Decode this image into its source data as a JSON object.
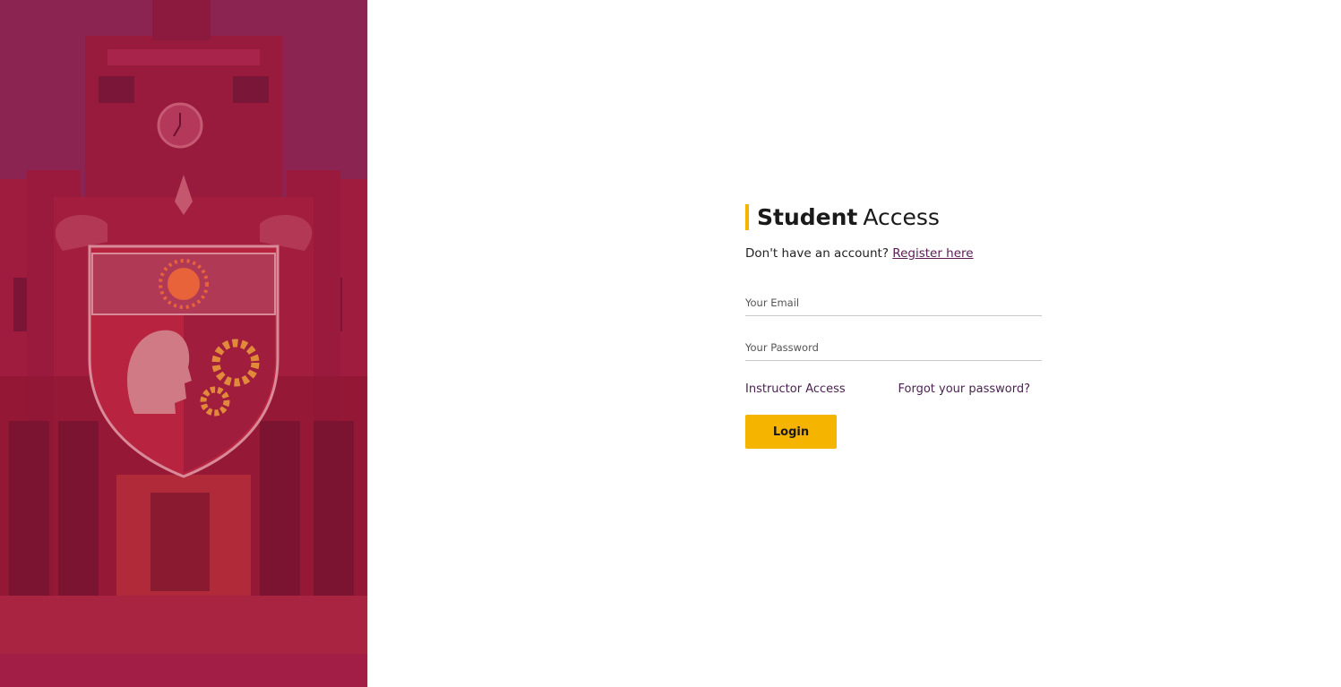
{
  "hero": {
    "image": "university-building-with-crest",
    "overlay_color": "#9e1c46"
  },
  "login": {
    "title_bold": "Student",
    "title_light": "Access",
    "register_prompt": "Don't have an account?",
    "register_link": "Register here",
    "email_placeholder": "Your Email",
    "email_value": "",
    "password_placeholder": "Your Password",
    "password_value": "",
    "instructor_link": "Instructor Access",
    "forgot_link": "Forgot your password?",
    "login_button": "Login"
  },
  "colors": {
    "accent": "#f5b400",
    "link": "#5b1b56",
    "hero_overlay": "#9e1c46"
  }
}
